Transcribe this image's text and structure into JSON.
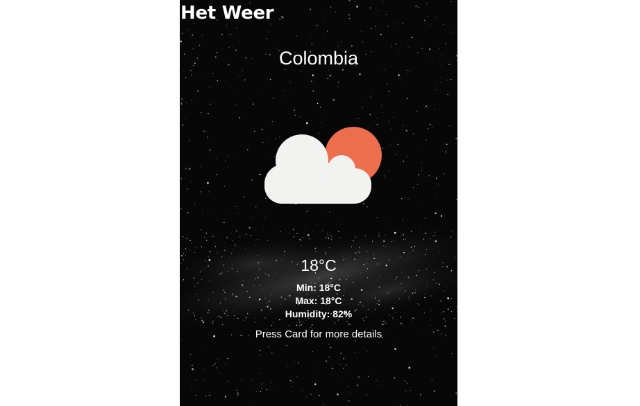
{
  "header": {
    "title": "Het Weer"
  },
  "card": {
    "city": "Colombia",
    "icon": "partly-cloudy-day-icon",
    "temperature": "18°C",
    "min": "Min: 18°C",
    "max": "Max: 18°C",
    "humidity": "Humidity: 82%",
    "hint": "Press Card for more details"
  },
  "colors": {
    "background": "#070707",
    "sun": "#ec6e4c",
    "cloud": "#f2f2f0",
    "text": "#ffffff"
  }
}
